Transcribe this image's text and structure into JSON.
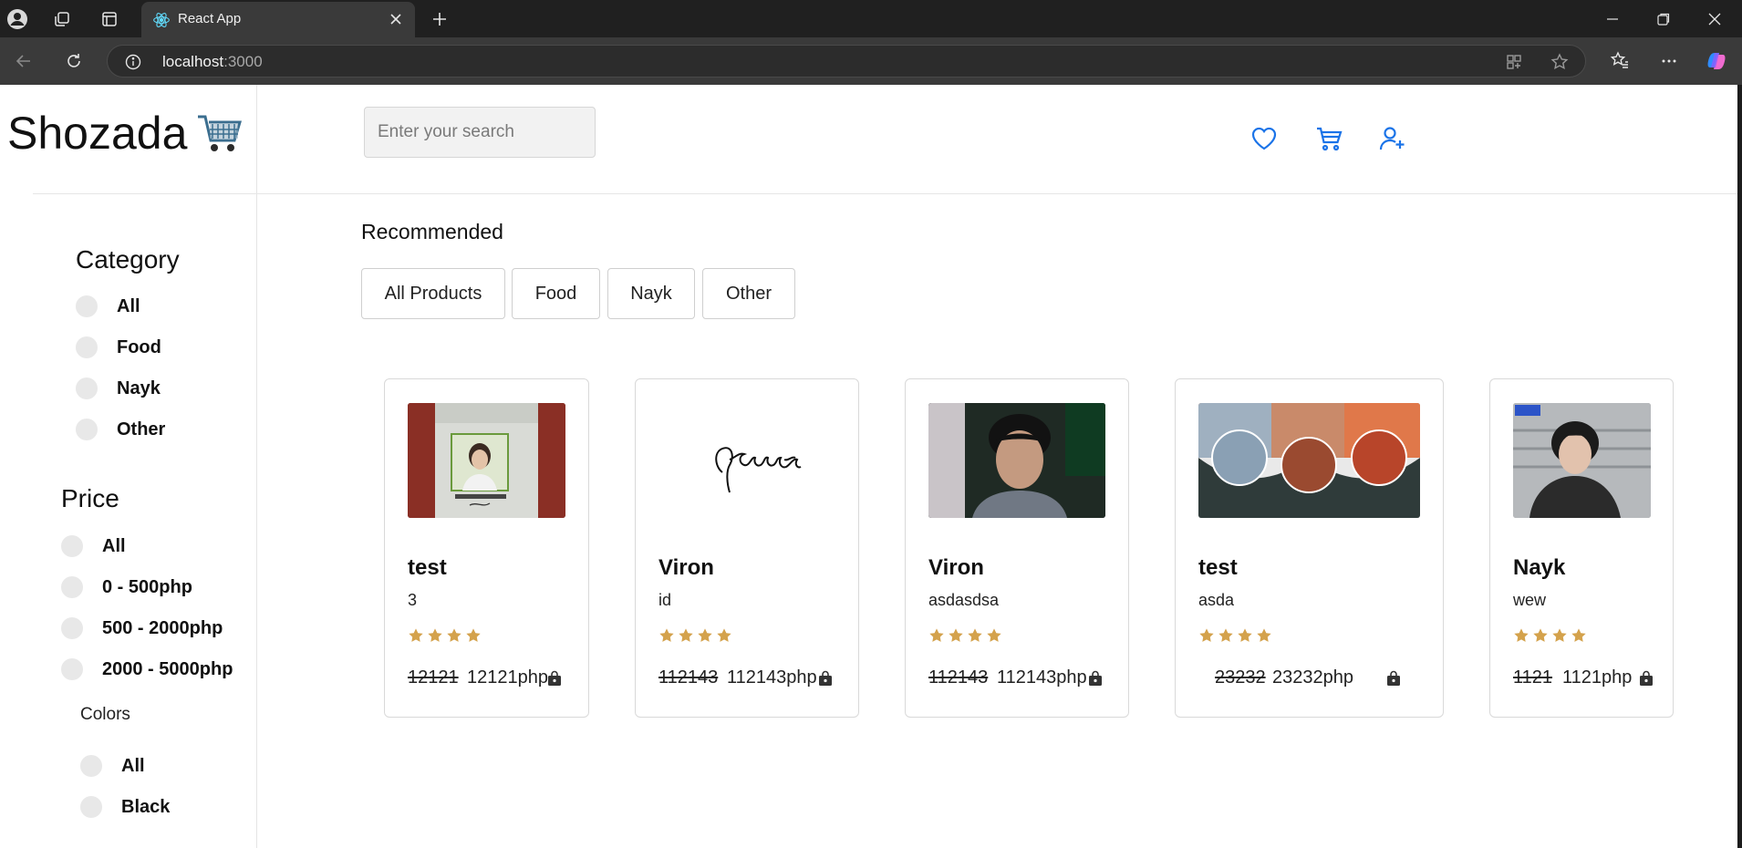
{
  "browser": {
    "tab_title": "React App",
    "url_host": "localhost",
    "url_port": ":3000"
  },
  "brand": {
    "name": "Shozada",
    "accent_color": "#1a73e8",
    "star_color": "#d4a24c"
  },
  "search": {
    "placeholder": "Enter your search"
  },
  "sidebar": {
    "category_heading": "Category",
    "categories": [
      "All",
      "Food",
      "Nayk",
      "Other"
    ],
    "price_heading": "Price",
    "prices": [
      "All",
      "0 - 500php",
      "500 - 2000php",
      "2000 - 5000php"
    ],
    "colors_heading": "Colors",
    "colors": [
      "All",
      "Black"
    ]
  },
  "main": {
    "recommended_title": "Recommended",
    "filters": [
      "All Products",
      "Food",
      "Nayk",
      "Other"
    ],
    "products": [
      {
        "title": "test",
        "description": "3",
        "rating": 4,
        "old_price": "12121",
        "new_price": "12121php",
        "image": "id-card-photo"
      },
      {
        "title": "Viron",
        "description": "id",
        "rating": 4,
        "old_price": "112143",
        "new_price": "112143php",
        "image": "signature"
      },
      {
        "title": "Viron",
        "description": "asdasdsa",
        "rating": 4,
        "old_price": "112143",
        "new_price": "112143php",
        "image": "portrait-photo"
      },
      {
        "title": "test",
        "description": "asda",
        "rating": 4,
        "old_price": "23232",
        "new_price": "23232php",
        "image": "seafood-banner"
      },
      {
        "title": "Nayk",
        "description": "wew",
        "rating": 4,
        "old_price": "1121",
        "new_price": "1121php",
        "image": "portrait-photo"
      }
    ]
  }
}
